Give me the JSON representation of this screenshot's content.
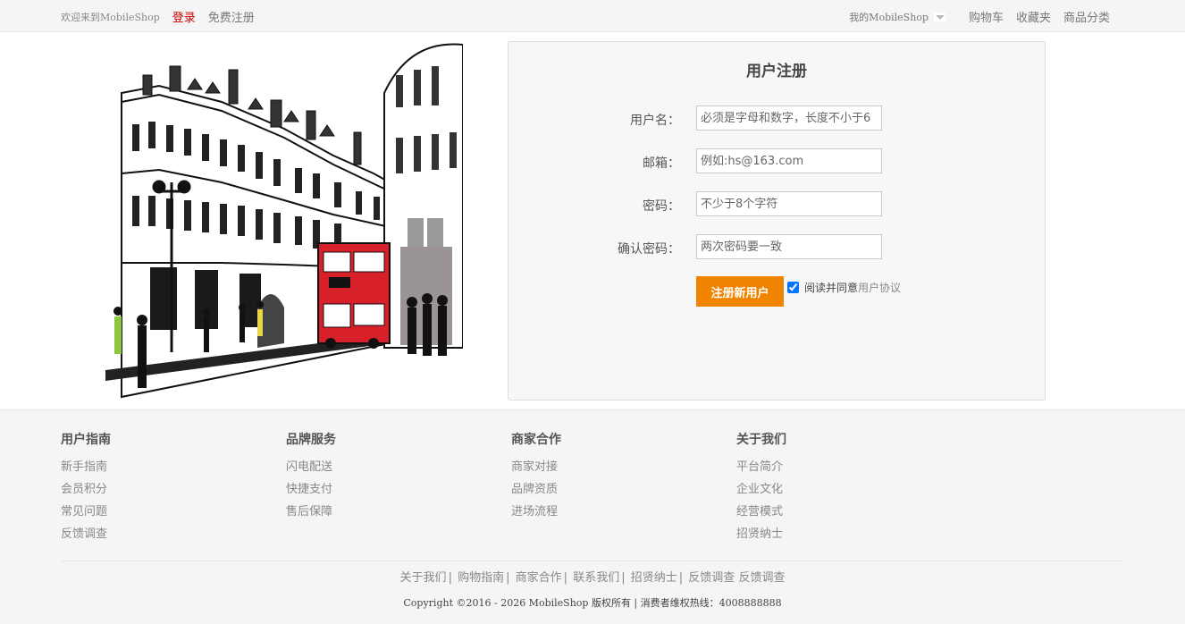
{
  "topbar": {
    "welcome": "欢迎来到MobileShop",
    "login": "登录",
    "register": "免费注册",
    "my_shop": "我的MobileShop",
    "cart": "购物车",
    "favorites": "收藏夹",
    "categories": "商品分类"
  },
  "form": {
    "title": "用户注册",
    "username_label": "用户名：",
    "username_placeholder": "必须是字母和数字，长度不小于6",
    "email_label": "邮箱：",
    "email_placeholder": "例如:hs@163.com",
    "password_label": "密码：",
    "password_placeholder": "不少于8个字符",
    "confirm_label": "确认密码：",
    "confirm_placeholder": "两次密码要一致",
    "submit": "注册新用户",
    "agree_text": "阅读并同意",
    "agree_link": "用户协议",
    "agree_checked": true
  },
  "footer": {
    "columns": [
      {
        "title": "用户指南",
        "items": [
          "新手指南",
          "会员积分",
          "常见问题",
          "反馈调查"
        ]
      },
      {
        "title": "品牌服务",
        "items": [
          "闪电配送",
          "快捷支付",
          "售后保障"
        ]
      },
      {
        "title": "商家合作",
        "items": [
          "商家对接",
          "品牌资质",
          "进场流程"
        ]
      },
      {
        "title": "关于我们",
        "items": [
          "平台简介",
          "企业文化",
          "经营模式",
          "招贤纳士"
        ]
      }
    ],
    "links": [
      "关于我们",
      "购物指南",
      "商家合作",
      "联系我们",
      "招贤纳士",
      "反馈调查",
      "反馈调查"
    ],
    "copyright": "Copyright ©2016 - 2026 MobileShop 版权所有 | 消费者维权热线：4008888888"
  },
  "colors": {
    "accent": "#f08300",
    "login": "#cc0000",
    "bus": "#d8202a"
  }
}
